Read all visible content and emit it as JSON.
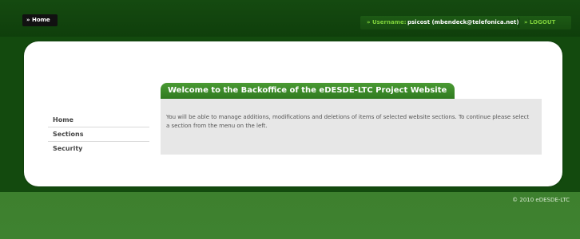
{
  "header": {
    "home_label": "» Home",
    "username_label": "» Username:",
    "username_value": "psicost (mbendeck@telefonica.net)",
    "logout_label": "» LOGOUT"
  },
  "sidebar": {
    "items": [
      {
        "label": "Home"
      },
      {
        "label": "Sections"
      },
      {
        "label": "Security"
      }
    ]
  },
  "main": {
    "title": "Welcome to the Backoffice of the eDESDE-LTC Project Website",
    "body": "You will be able to manage additions, modifications and deletions of items of selected website sections. To continue please select a section from the menu on the left."
  },
  "footer": {
    "copyright": "© 2010 eDESDE-LTC"
  }
}
